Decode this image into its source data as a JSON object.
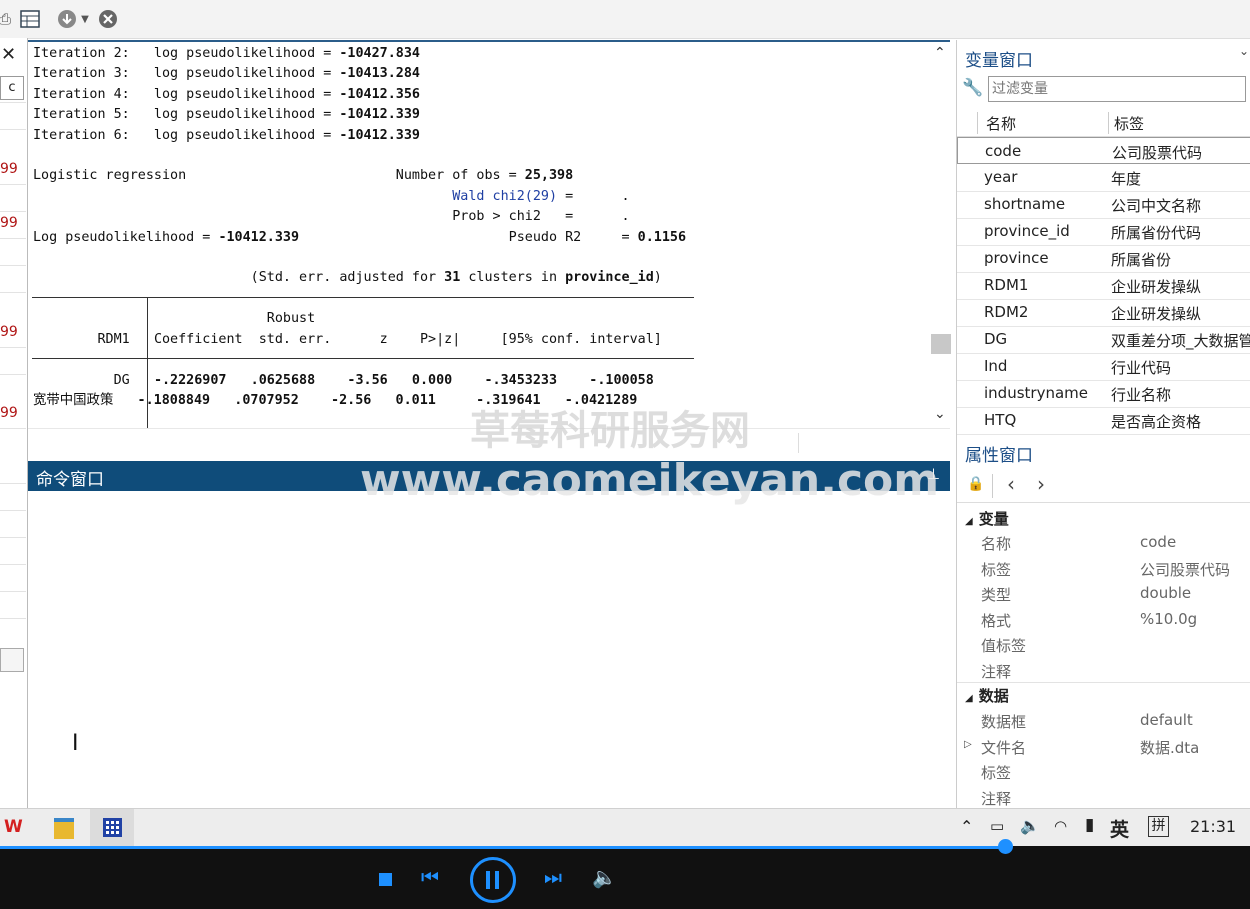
{
  "results": {
    "lines": [
      {
        "pre": "Iteration 2:   log pseudolikelihood = ",
        "val": "-10427.834"
      },
      {
        "pre": "Iteration 3:   log pseudolikelihood = ",
        "val": "-10413.284"
      },
      {
        "pre": "Iteration 4:   log pseudolikelihood = ",
        "val": "-10412.356"
      },
      {
        "pre": "Iteration 5:   log pseudolikelihood = ",
        "val": "-10412.339"
      },
      {
        "pre": "Iteration 6:   log pseudolikelihood = ",
        "val": "-10412.339"
      }
    ],
    "model_title": "Logistic regression",
    "nobs_label": "Number of obs = ",
    "nobs": "25,398",
    "wald_label": "Wald chi2(29)",
    "wald_eq": " =      .",
    "prob_label": "Prob > chi2   =      .",
    "ll_label": "Log pseudolikelihood = ",
    "ll_val": "-10412.339",
    "pseudo_label": "Pseudo R2     = ",
    "pseudo_val": "0.1156",
    "stderr_note_1": "(Std. err. adjusted for ",
    "stderr_clusters": "31",
    "stderr_note_2": " clusters in ",
    "stderr_var": "province_id",
    "stderr_note_3": ")",
    "header_robust": "Robust",
    "header_depvar": "RDM1",
    "header_cols": "Coefficient  std. err.      z    P>|z|     [95% conf. interval]",
    "rows": [
      {
        "name": "DG",
        "vals": "-.2226907   .0625688    -3.56   0.000    -.3453233    -.100058"
      },
      {
        "name": "宽带中国政策",
        "vals": "-.1808849   .0707952    -2.56   0.011     -.319641   -.0421289"
      }
    ]
  },
  "left_strip": {
    "values": [
      "99",
      "99",
      "99",
      "99"
    ],
    "letter": "c"
  },
  "command_window": {
    "title": "命令窗口"
  },
  "watermark": {
    "line1": "草莓科研服务网",
    "line2": "www.caomeikeyan.com"
  },
  "variables": {
    "title": "变量窗口",
    "filter_placeholder": "过滤变量",
    "col_name": "名称",
    "col_label": "标签",
    "items": [
      {
        "name": "code",
        "label": "公司股票代码"
      },
      {
        "name": "year",
        "label": "年度"
      },
      {
        "name": "shortname",
        "label": "公司中文名称"
      },
      {
        "name": "province_id",
        "label": "所属省份代码"
      },
      {
        "name": "province",
        "label": "所属省份"
      },
      {
        "name": "RDM1",
        "label": "企业研发操纵"
      },
      {
        "name": "RDM2",
        "label": "企业研发操纵"
      },
      {
        "name": "DG",
        "label": "双重差分项_大数据管"
      },
      {
        "name": "Ind",
        "label": "行业代码"
      },
      {
        "name": "industryname",
        "label": "行业名称"
      },
      {
        "name": "HTQ",
        "label": "是否高企资格"
      }
    ]
  },
  "properties": {
    "title": "属性窗口",
    "section_variable": "变量",
    "variable_props": [
      {
        "key": "名称",
        "value": "code"
      },
      {
        "key": "标签",
        "value": "公司股票代码"
      },
      {
        "key": "类型",
        "value": "double"
      },
      {
        "key": "格式",
        "value": "%10.0g"
      },
      {
        "key": "值标签",
        "value": ""
      },
      {
        "key": "注释",
        "value": ""
      }
    ],
    "section_data": "数据",
    "data_props": [
      {
        "key": "数据框",
        "value": "default"
      },
      {
        "key": "文件名",
        "value": "数据.dta"
      },
      {
        "key": "标签",
        "value": ""
      },
      {
        "key": "注释",
        "value": ""
      }
    ]
  },
  "taskbar": {
    "ime_lang": "英",
    "ime_mode": "拼",
    "time": "21:31"
  },
  "colors": {
    "accent": "#0f4c7a",
    "title_blue": "#1c4e87",
    "media_blue": "#1e90ff"
  }
}
